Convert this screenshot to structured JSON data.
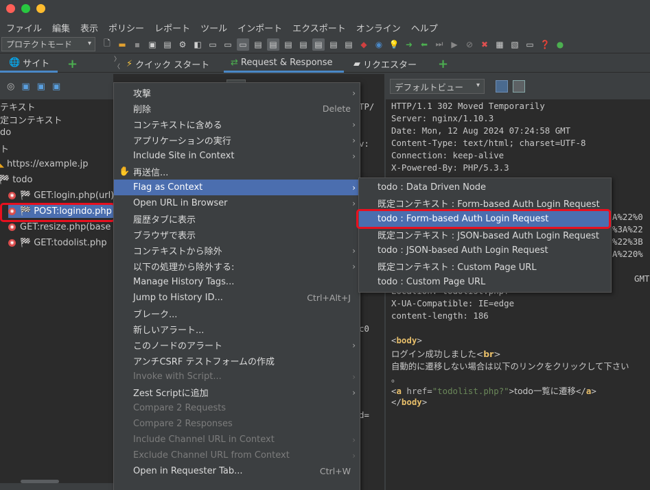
{
  "window": {
    "buttons": [
      {
        "color": "#ff5f57"
      },
      {
        "color": "#28c840"
      },
      {
        "color": "#febc2e"
      }
    ]
  },
  "menubar": [
    "ファイル",
    "編集",
    "表示",
    "ポリシー",
    "レポート",
    "ツール",
    "インポート",
    "エクスポート",
    "オンライン",
    "ヘルプ"
  ],
  "toolbar": {
    "mode_label": "プロテクトモード"
  },
  "tabs": {
    "sites": "サイト",
    "quick_start": "クイック スタート",
    "request_response": "Request & Response",
    "requester": "リクエスター"
  },
  "tree": {
    "rows": [
      {
        "label": "テキスト"
      },
      {
        "label": "定コンテキスト"
      },
      {
        "label": "do"
      },
      {
        "label": "ト"
      },
      {
        "label": "https://example.jp"
      },
      {
        "label": "todo"
      },
      {
        "label": "GET:login.php(url)"
      },
      {
        "label": "POST:logindo.php"
      },
      {
        "label": "GET:resize.php(base"
      },
      {
        "label": "GET:todolist.php"
      }
    ]
  },
  "center_fragments": [
    "TP/",
    "v:",
    "c0",
    "d="
  ],
  "response": {
    "view_label": "デフォルトビュー",
    "lines": [
      "HTTP/1.1 302 Moved Temporarily",
      "Server: nginx/1.10.3",
      "Date: Mon, 12 Aug 2024 07:24:58 GMT",
      "Content-Type: text/html; charset=UTF-8",
      "Connection: keep-alive",
      "X-Powered-By: PHP/5.3.3"
    ],
    "right_fragments": [
      "A%22%0",
      "%3A%22",
      "%22%3B",
      "A%220%",
      "GMT"
    ],
    "lines2": [
      "Location: todolist.php?",
      "X-UA-Compatible: IE=edge",
      "content-length: 186"
    ],
    "body": {
      "open_tag": "body",
      "line1_text": "ログイン成功しました",
      "br_tag": "br",
      "line2": "自動的に遷移しない場合は以下のリンクをクリックして下さい",
      "line3": "。",
      "a_tag": "a",
      "href_attr": "href",
      "href_val": "\"todolist.php?\"",
      "link_text": "todo一覧に遷移",
      "close_a": "a",
      "close_body": "body"
    }
  },
  "context_menu": [
    {
      "label": "攻撃",
      "arrow": true
    },
    {
      "label": "削除",
      "shortcut": "Delete"
    },
    {
      "label": "コンテキストに含める",
      "arrow": true
    },
    {
      "label": "アプリケーションの実行",
      "arrow": true
    },
    {
      "label": "Include Site in Context",
      "arrow": true
    },
    {
      "label": "再送信...",
      "icon": "hand-icon"
    },
    {
      "label": "Flag as Context",
      "arrow": true,
      "highlight": true
    },
    {
      "label": "Open URL in Browser",
      "arrow": true
    },
    {
      "label": "履歴タブに表示"
    },
    {
      "label": "ブラウザで表示"
    },
    {
      "label": "コンテキストから除外",
      "arrow": true
    },
    {
      "label": "以下の処理から除外する:",
      "arrow": true
    },
    {
      "label": "Manage History Tags..."
    },
    {
      "label": "Jump to History ID...",
      "shortcut": "Ctrl+Alt+J"
    },
    {
      "label": "ブレーク..."
    },
    {
      "label": "新しいアラート..."
    },
    {
      "label": "このノードのアラート",
      "arrow": true
    },
    {
      "label": "アンチCSRF テストフォームの作成"
    },
    {
      "label": "Invoke with Script...",
      "arrow": true,
      "disabled": true
    },
    {
      "label": "Zest Scriptに追加",
      "arrow": true
    },
    {
      "label": "Compare 2 Requests",
      "disabled": true
    },
    {
      "label": "Compare 2 Responses",
      "disabled": true
    },
    {
      "label": "Include Channel URL in Context",
      "arrow": true,
      "disabled": true
    },
    {
      "label": "Exclude Channel URL from Context",
      "arrow": true,
      "disabled": true
    },
    {
      "label": "Open in Requester Tab...",
      "shortcut": "Ctrl+W"
    }
  ],
  "submenu": [
    {
      "label": "todo : Data Driven Node"
    },
    {
      "label": "既定コンテキスト : Form-based Auth Login Request"
    },
    {
      "label": "todo : Form-based Auth Login Request",
      "highlight": true
    },
    {
      "label": "既定コンテキスト : JSON-based Auth Login Request"
    },
    {
      "label": "todo : JSON-based Auth Login Request"
    },
    {
      "label": "既定コンテキスト : Custom Page URL"
    },
    {
      "label": "todo : Custom Page URL"
    }
  ],
  "colors": {
    "highlight": "#4b6eaf",
    "outline": "#e8101f",
    "accent_tab": "#4a88c7",
    "plus": "#4caf50",
    "flag": "#e8a31c"
  }
}
